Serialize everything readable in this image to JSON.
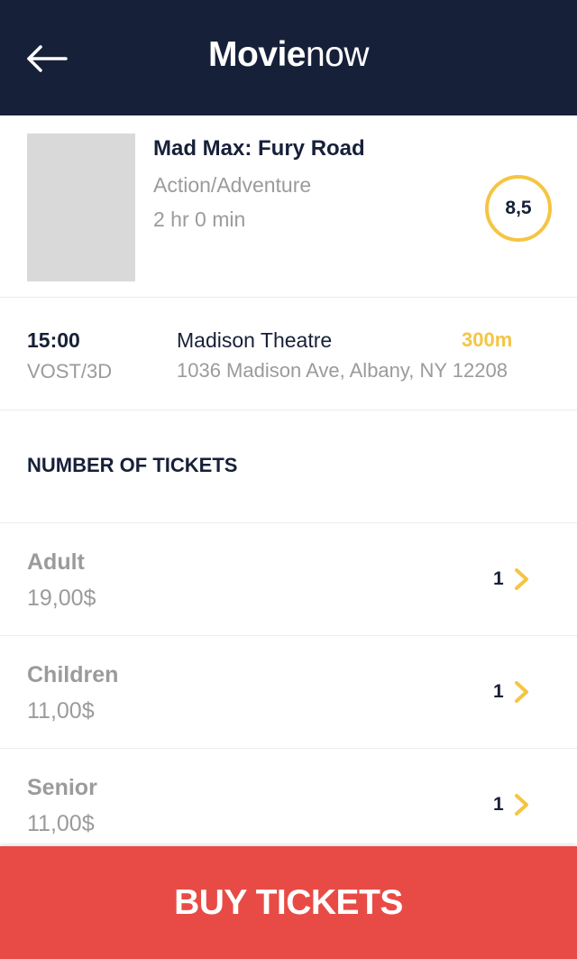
{
  "header": {
    "brand_bold": "Movie",
    "brand_light": "now",
    "back_icon": "arrow-left-icon"
  },
  "movie": {
    "title": "Mad Max: Fury Road",
    "genre": "Action/Adventure",
    "duration": "2 hr 0 min",
    "rating": "8,5"
  },
  "session": {
    "time": "15:00",
    "format": "VOST/3D",
    "theatre": "Madison Theatre",
    "distance": "300m",
    "address": "1036 Madison Ave, Albany, NY 12208"
  },
  "tickets_section": {
    "title": "NUMBER OF TICKETS"
  },
  "tickets": [
    {
      "type": "Adult",
      "price": "19,00$",
      "count": "1"
    },
    {
      "type": "Children",
      "price": "11,00$",
      "count": "1"
    },
    {
      "type": "Senior",
      "price": "11,00$",
      "count": "1"
    }
  ],
  "buy_button": {
    "label": "BUY TICKETS"
  },
  "colors": {
    "header_bg": "#172039",
    "accent_yellow": "#f5c542",
    "buy_red": "#e84b45",
    "muted_gray": "#9b9b9b"
  }
}
